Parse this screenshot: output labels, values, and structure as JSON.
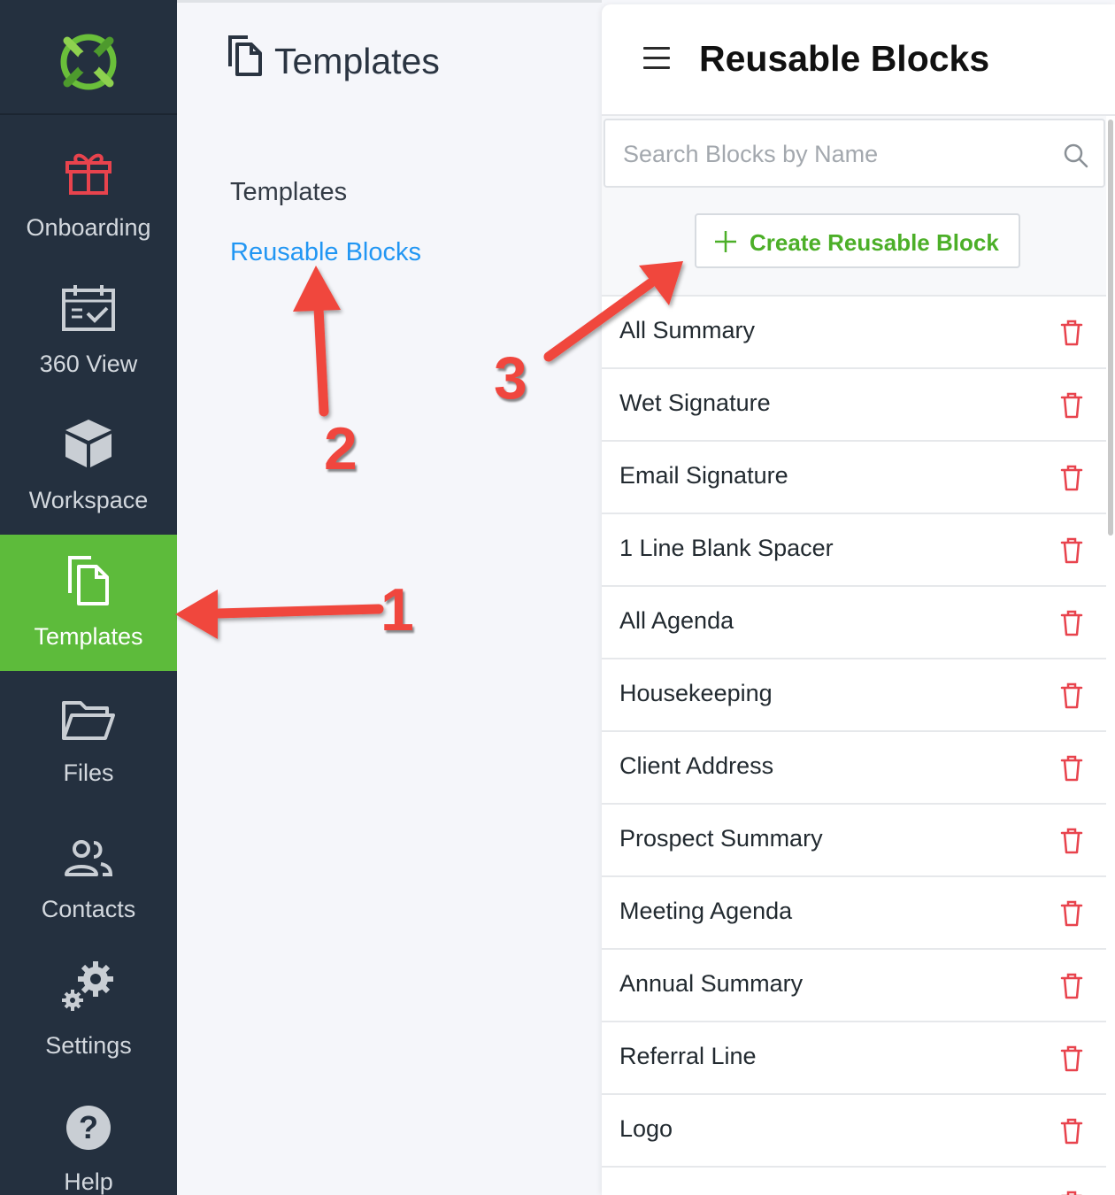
{
  "sidebar": {
    "items": [
      {
        "label": "Onboarding",
        "icon": "gift-icon"
      },
      {
        "label": "360 View",
        "icon": "calendar-check-icon"
      },
      {
        "label": "Workspace",
        "icon": "cube-icon"
      },
      {
        "label": "Templates",
        "icon": "copy-icon",
        "active": true
      },
      {
        "label": "Files",
        "icon": "folder-icon"
      },
      {
        "label": "Contacts",
        "icon": "people-icon"
      },
      {
        "label": "Settings",
        "icon": "gears-icon"
      },
      {
        "label": "Help",
        "icon": "question-circle-icon"
      }
    ]
  },
  "middle": {
    "title": "Templates",
    "links": [
      {
        "label": "Templates"
      },
      {
        "label": "Reusable Blocks",
        "active": true
      }
    ]
  },
  "right": {
    "title": "Reusable Blocks",
    "search_placeholder": "Search Blocks by Name",
    "create_label": "Create Reusable Block",
    "blocks": [
      "All Summary",
      "Wet Signature",
      "Email Signature",
      "1 Line Blank Spacer",
      "All Agenda",
      "Housekeeping",
      "Client Address",
      "Prospect Summary",
      "Meeting Agenda",
      "Annual Summary",
      "Referral Line",
      "Logo"
    ]
  },
  "annotations": [
    "1",
    "2",
    "3"
  ],
  "colors": {
    "sidebar_bg": "#24303f",
    "active_green": "#5dbb3b",
    "link_blue": "#2196f3",
    "create_green": "#4caf28",
    "delete_red": "#e8434d",
    "annotation_red": "#f0463e"
  }
}
